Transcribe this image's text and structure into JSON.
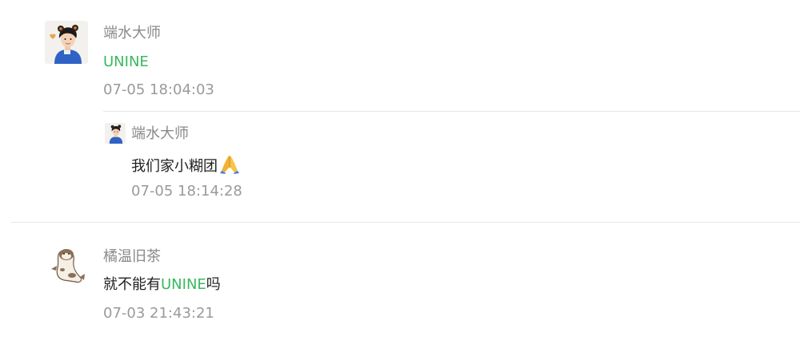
{
  "comments": [
    {
      "username": "端水大师",
      "mention": "UNINE",
      "text_before": "",
      "text_after": "",
      "time": "07-05 18:04:03",
      "avatar_icon": "boy-avatar-icon",
      "reply": {
        "username": "端水大师",
        "text": "我们家小糊团",
        "emoji": "folded-hands-icon",
        "time": "07-05 18:14:28",
        "avatar_icon": "boy-avatar-icon"
      }
    },
    {
      "username": "橘温旧茶",
      "text_before": "就不能有",
      "mention": "UNINE",
      "text_after": "吗",
      "time": "07-03 21:43:21",
      "avatar_icon": "seal-cartoon-avatar-icon"
    }
  ],
  "colors": {
    "mention": "#3ab85f",
    "name": "#8a8a8a",
    "time": "#9a9a9a",
    "text": "#1f1f1f"
  }
}
